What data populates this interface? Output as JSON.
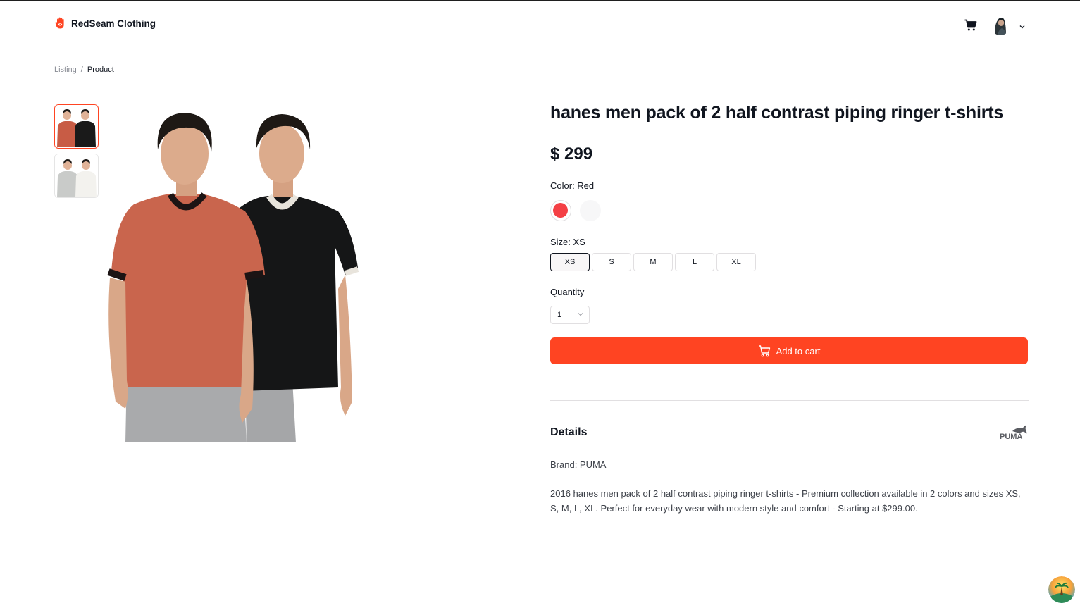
{
  "header": {
    "logo_text": "RedSeam Clothing",
    "logo_icon": "hand-eye-icon",
    "cart_icon": "cart-icon",
    "avatar_alt": "user-avatar",
    "menu_icon": "chevron-down-icon"
  },
  "breadcrumb": {
    "items": [
      "Listing",
      "Product"
    ],
    "separator": "/"
  },
  "product": {
    "title": "hanes men pack of 2 half contrast piping ringer t-shirts",
    "price": "$ 299",
    "color_label": "Color: Red",
    "colors": [
      {
        "name": "Red",
        "hex": "#f44045",
        "selected": true
      },
      {
        "name": "White",
        "hex": "#f7f7f8",
        "selected": false
      }
    ],
    "size_label": "Size: XS",
    "sizes": [
      "XS",
      "S",
      "M",
      "L",
      "XL"
    ],
    "selected_size": "XS",
    "quantity_label": "Quantity",
    "quantity_value": "1",
    "add_to_cart_label": "Add to cart",
    "thumbnails": [
      "red-black-pack",
      "grey-white-pack"
    ],
    "selected_thumbnail": 0
  },
  "details": {
    "title": "Details",
    "brand_logo": "puma-logo",
    "brand_line": "Brand: PUMA",
    "description": "2016 hanes men pack of 2 half contrast piping ringer t-shirts - Premium collection available in 2 colors and sizes XS, S, M, L, XL. Perfect for everyday wear with modern style and comfort - Starting at $299.00."
  },
  "colors": {
    "accent": "#ff4422",
    "text": "#10151f",
    "muted": "#8a8d95",
    "border": "#e1dfe1"
  }
}
